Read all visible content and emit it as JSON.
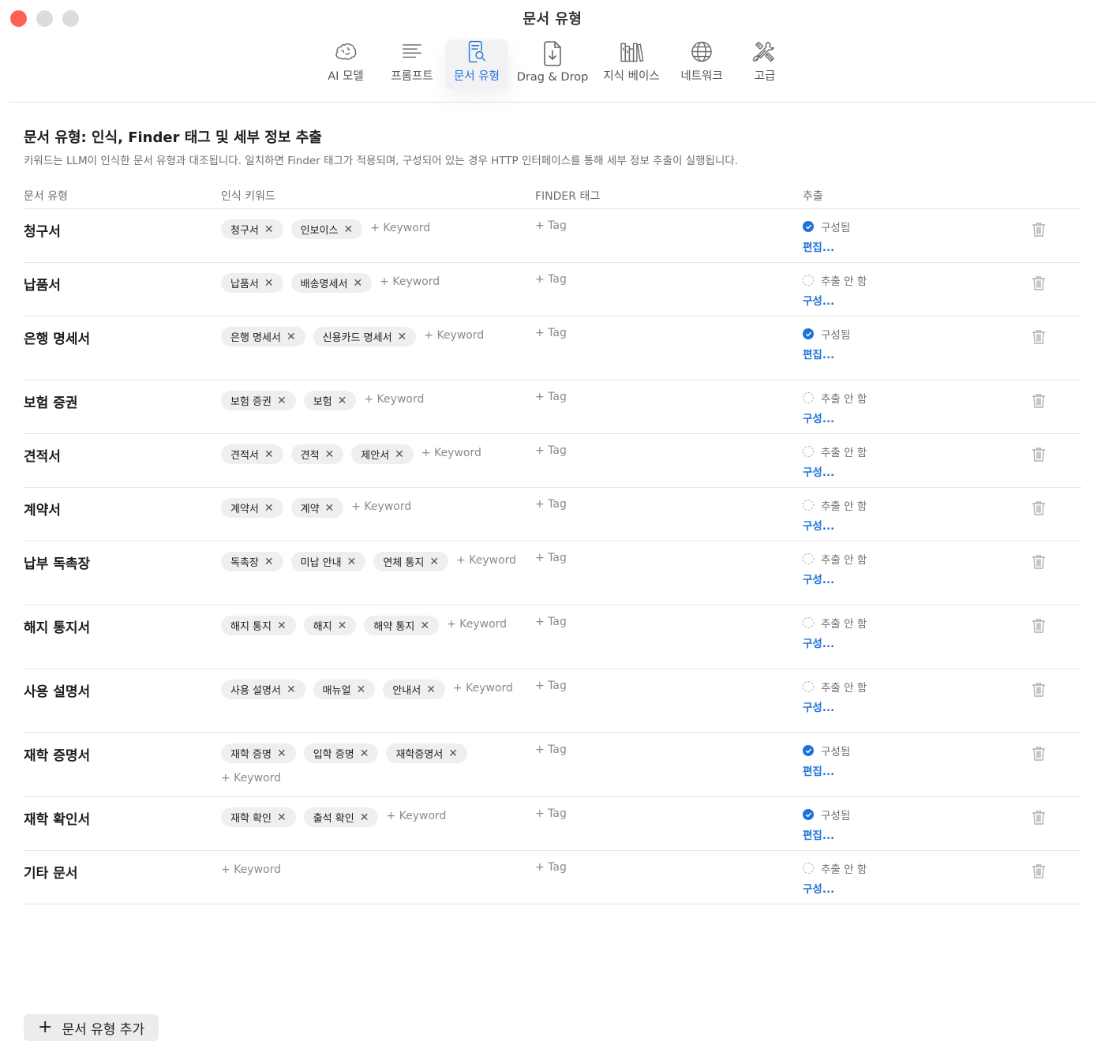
{
  "window": {
    "title": "문서 유형"
  },
  "toolbar": {
    "tabs": [
      {
        "label": "AI 모델",
        "icon": "brain-icon"
      },
      {
        "label": "프롬프트",
        "icon": "text-lines-icon"
      },
      {
        "label": "문서 유형",
        "icon": "document-search-icon",
        "active": true
      },
      {
        "label": "Drag & Drop",
        "icon": "document-download-icon"
      },
      {
        "label": "지식 베이스",
        "icon": "books-icon"
      },
      {
        "label": "네트워크",
        "icon": "globe-icon"
      },
      {
        "label": "고급",
        "icon": "tools-icon"
      }
    ]
  },
  "page": {
    "heading": "문서 유형: 인식, Finder 태그 및 세부 정보 추출",
    "subheading": "키워드는 LLM이 인식한 문서 유형과 대조됩니다. 일치하면 Finder 태그가 적용되며, 구성되어 있는 경우 HTTP 인터페이스를 통해 세부 정보 추출이 실행됩니다."
  },
  "table": {
    "headers": {
      "type": "문서 유형",
      "keywords": "인식 키워드",
      "tags": "FINDER 태그",
      "extract": "추출"
    },
    "add_keyword_label": "+ Keyword",
    "add_tag_label": "+ Tag",
    "status_configured": "구성됨",
    "status_not": "추출 안 함",
    "edit_label": "편집...",
    "configure_label": "구성...",
    "accent_color": "#1e73d8",
    "rows": [
      {
        "name": "청구서",
        "keywords": [
          "청구서",
          "인보이스"
        ],
        "configured": true
      },
      {
        "name": "납품서",
        "keywords": [
          "납품서",
          "배송명세서"
        ],
        "configured": false
      },
      {
        "name": "은행 명세서",
        "keywords": [
          "은행 명세서",
          "신용카드 명세서"
        ],
        "configured": true
      },
      {
        "name": "보험 증권",
        "keywords": [
          "보험 증권",
          "보험"
        ],
        "configured": false
      },
      {
        "name": "견적서",
        "keywords": [
          "견적서",
          "견적",
          "제안서"
        ],
        "configured": false
      },
      {
        "name": "계약서",
        "keywords": [
          "계약서",
          "계약"
        ],
        "configured": false
      },
      {
        "name": "납부 독촉장",
        "keywords": [
          "독촉장",
          "미납 안내",
          "연체 통지"
        ],
        "configured": false
      },
      {
        "name": "해지 통지서",
        "keywords": [
          "해지 통지",
          "해지",
          "해약 통지"
        ],
        "configured": false
      },
      {
        "name": "사용 설명서",
        "keywords": [
          "사용 설명서",
          "매뉴얼",
          "안내서"
        ],
        "configured": false
      },
      {
        "name": "재학 증명서",
        "keywords": [
          "재학 증명",
          "입학 증명",
          "재학증명서"
        ],
        "configured": true
      },
      {
        "name": "재학 확인서",
        "keywords": [
          "재학 확인",
          "출석 확인"
        ],
        "configured": true
      },
      {
        "name": "기타 문서",
        "keywords": [],
        "configured": false
      }
    ]
  },
  "footer": {
    "add_type_label": "문서 유형 추가"
  }
}
